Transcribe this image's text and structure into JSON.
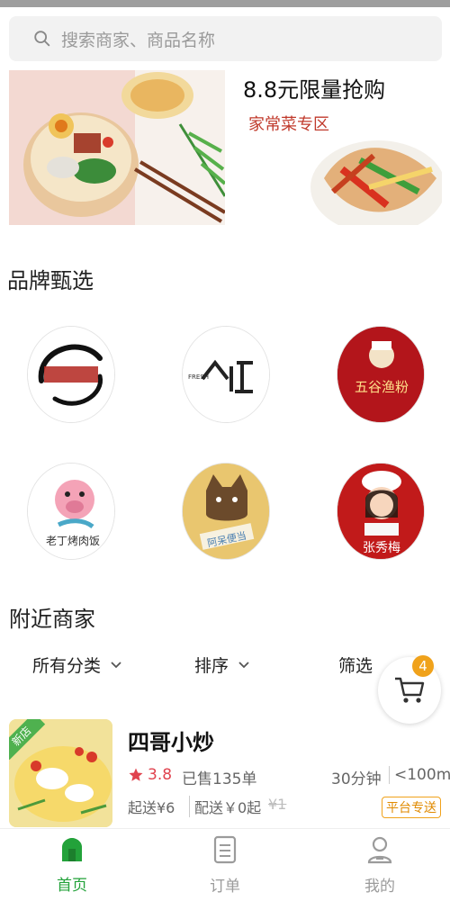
{
  "search": {
    "placeholder": "搜索商家、商品名称"
  },
  "banner": {
    "title": "8.8元限量抢购",
    "subtitle": "家常菜专区"
  },
  "brands": {
    "title": "品牌甄选",
    "items": [
      {
        "name": "brand-logo-1"
      },
      {
        "name": "brand-logo-2"
      },
      {
        "name": "brand-logo-3"
      },
      {
        "name": "brand-logo-4"
      },
      {
        "name": "brand-logo-5"
      },
      {
        "name": "brand-logo-6"
      }
    ],
    "logo_text": {
      "b2": "FRESH",
      "b3": "五谷渔粉",
      "b4": "老丁烤肉饭",
      "b5": "阿呆便当",
      "b6": "张秀梅"
    }
  },
  "nearby": {
    "title": "附近商家",
    "filters": {
      "category": "所有分类",
      "sort": "排序",
      "filter": "筛选"
    }
  },
  "cart": {
    "badge": "4"
  },
  "shop": {
    "new_tag": "新店",
    "name": "四哥小炒",
    "rating": "3.8",
    "sold": "已售135单",
    "time": "30分钟",
    "distance": "<100m",
    "min_order": "起送¥6",
    "delivery": "配送￥0起",
    "orig_delivery": "¥1",
    "platform_tag": "平台专送"
  },
  "tabbar": {
    "home": "首页",
    "orders": "订单",
    "mine": "我的"
  },
  "colors": {
    "accent": "#23a23a",
    "badge": "#f0a21b",
    "star": "#e0424e"
  }
}
